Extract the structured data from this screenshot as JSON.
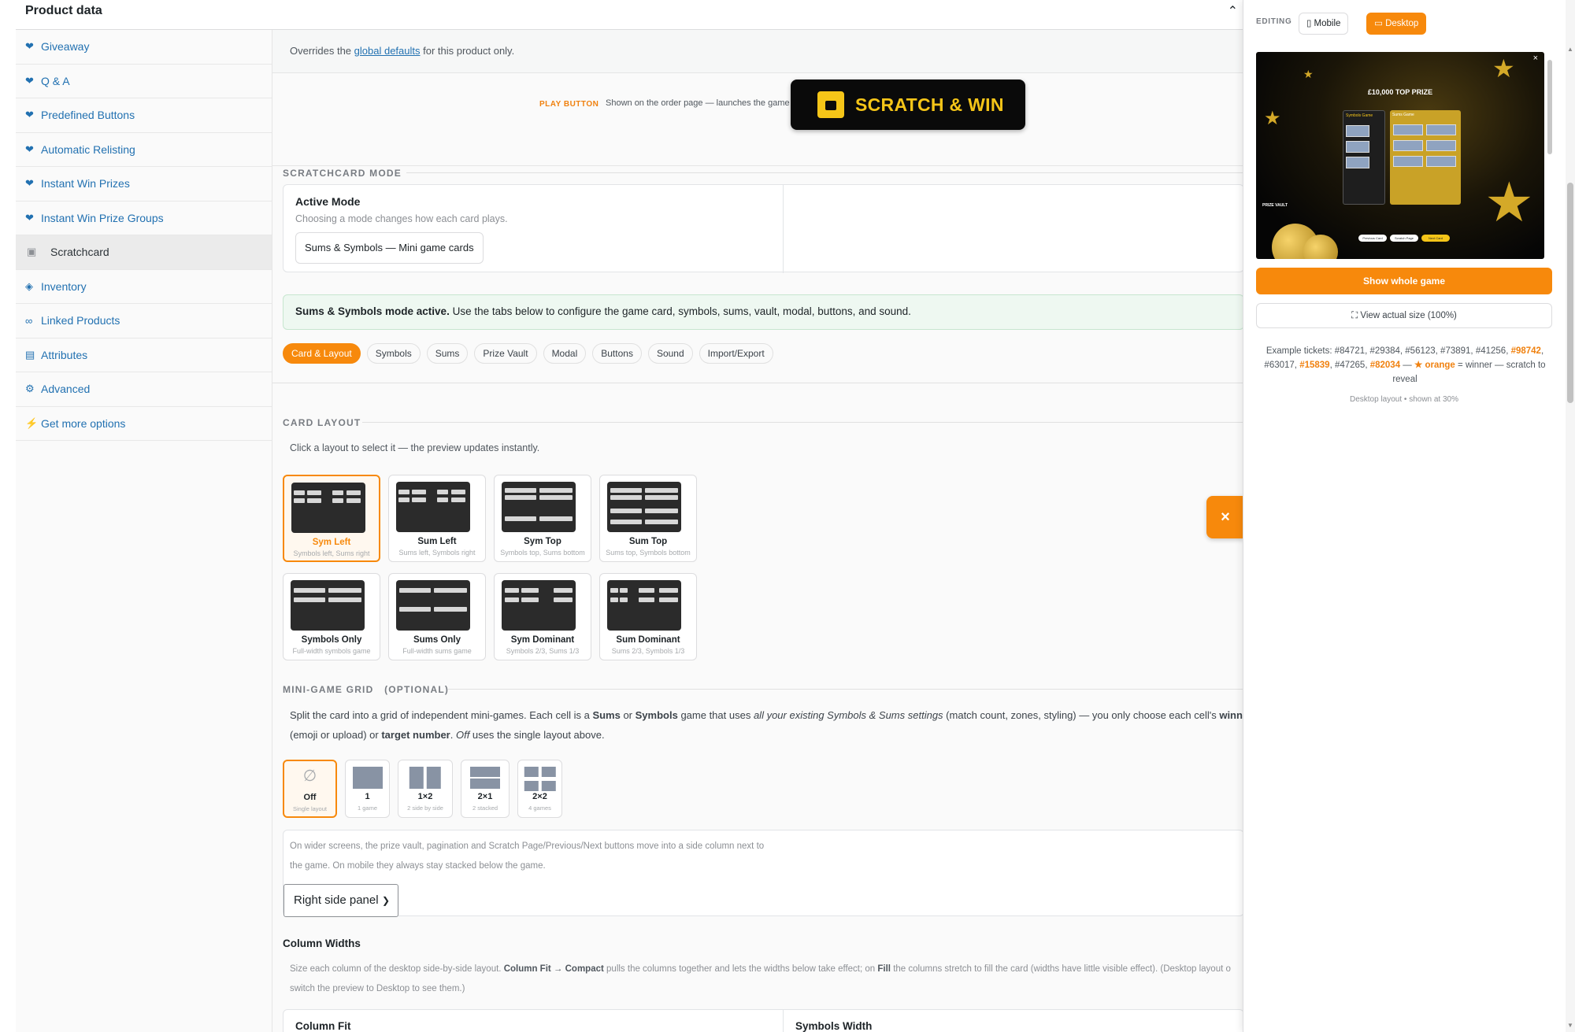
{
  "header": {
    "title": "Product data",
    "toggle_icon": "chevron-up-icon"
  },
  "sidebar": {
    "items": [
      {
        "label": "Giveaway",
        "icon": "gift-icon"
      },
      {
        "label": "Q & A",
        "icon": "question-icon"
      },
      {
        "label": "Predefined Buttons",
        "icon": "buttons-icon"
      },
      {
        "label": "Automatic Relisting",
        "icon": "relist-icon"
      },
      {
        "label": "Instant Win Prizes",
        "icon": "prize-icon"
      },
      {
        "label": "Instant Win Prize Groups",
        "icon": "prize-groups-icon"
      },
      {
        "label": "Scratchcard",
        "icon": "scratchcard-icon",
        "active": true
      },
      {
        "label": "Inventory",
        "icon": "inventory-icon"
      },
      {
        "label": "Linked Products",
        "icon": "link-icon"
      },
      {
        "label": "Attributes",
        "icon": "attributes-icon"
      },
      {
        "label": "Advanced",
        "icon": "gear-icon"
      },
      {
        "label": "Get more options",
        "icon": "plugin-icon"
      }
    ]
  },
  "overrides": {
    "prefix": "Overrides the ",
    "link": "global defaults",
    "suffix": " for this product only."
  },
  "play": {
    "label": "PLAY BUTTON",
    "desc": "Shown on the order page — launches the game",
    "button_text": "SCRATCH & WIN"
  },
  "scratchcard_mode": {
    "section": "SCRATCHCARD MODE",
    "title": "Active Mode",
    "subtitle": "Choosing a mode changes how each card plays.",
    "selected": "Sums & Symbols — Mini game cards"
  },
  "banner": {
    "bold": "Sums & Symbols mode active.",
    "rest": " Use the tabs below to configure the game card, symbols, sums, vault, modal, buttons, and sound."
  },
  "tabs": [
    "Card & Layout",
    "Symbols",
    "Sums",
    "Prize Vault",
    "Modal",
    "Buttons",
    "Sound",
    "Import/Export"
  ],
  "active_tab": "Card & Layout",
  "card_layout": {
    "section": "CARD LAYOUT",
    "hint": "Click a layout to select it — the preview updates instantly.",
    "options": [
      {
        "name": "Sym Left",
        "desc": "Symbols left, Sums right"
      },
      {
        "name": "Sum Left",
        "desc": "Sums left, Symbols right"
      },
      {
        "name": "Sym Top",
        "desc": "Symbols top, Sums bottom"
      },
      {
        "name": "Sum Top",
        "desc": "Sums top, Symbols bottom"
      },
      {
        "name": "Symbols Only",
        "desc": "Full-width symbols game"
      },
      {
        "name": "Sums Only",
        "desc": "Full-width sums game"
      },
      {
        "name": "Sym Dominant",
        "desc": "Symbols 2/3, Sums 1/3"
      },
      {
        "name": "Sum Dominant",
        "desc": "Sums 2/3, Symbols 1/3"
      }
    ],
    "selected": "Sym Left"
  },
  "mini_grid": {
    "section": "MINI-GAME GRID",
    "optional": "(OPTIONAL)",
    "desc_1a": "Split the card into a grid of independent mini-games. Each cell is a ",
    "sums": "Sums",
    "or": " or ",
    "symbols": "Symbols",
    "desc_1b": " game that uses ",
    "italic": "all your existing Symbols & Sums settings",
    "desc_1c": " (match count, zones, styling) — you only choose each cell's ",
    "winning": "winning sym",
    "desc_2a": "(emoji or upload) or ",
    "target": "target number",
    "desc_2b": ". ",
    "off_italic": "Off",
    "desc_2c": " uses the single layout above.",
    "options": [
      {
        "label": "Off",
        "sub": "Single layout"
      },
      {
        "label": "1",
        "sub": "1 game"
      },
      {
        "label": "1×2",
        "sub": "2 side by side"
      },
      {
        "label": "2×1",
        "sub": "2 stacked"
      },
      {
        "label": "2×2",
        "sub": "4 games"
      }
    ],
    "selected": "Off"
  },
  "side_panel": {
    "text_1": "On wider screens, the prize vault, pagination and Scratch Page/Previous/Next buttons move into a side column next to",
    "text_2": "the game. On mobile they always stay stacked below the game.",
    "select_value": "Right side panel"
  },
  "column_widths": {
    "title": "Column Widths",
    "text_1a": "Size each column of the desktop side-by-side layout. ",
    "cf": "Column Fit → Compact",
    "text_1b": " pulls the columns together and lets the widths below take effect; on ",
    "fill": "Fill",
    "text_1c": " the columns stretch to fill the card (widths have little visible effect). (Desktop layout o",
    "text_2": "switch the preview to Desktop to see them.)",
    "left_label": "Column Fit",
    "right_label": "Symbols Width"
  },
  "right_panel": {
    "editing": "EDITING",
    "mobile": "Mobile",
    "desktop": "Desktop",
    "active_device": "Desktop",
    "preview": {
      "title": "£10,000 TOP PRIZE",
      "vault_label": "PRIZE VAULT",
      "left_heading": "Symbols Game",
      "right_heading": "Sums Game",
      "buttons": [
        "Previous Card",
        "Scratch Page",
        "Next Card"
      ]
    },
    "show_whole": "Show whole game",
    "view_actual": "View actual size (100%)",
    "examples_prefix": "Example tickets: ",
    "tickets": [
      {
        "n": "#84721"
      },
      {
        "n": "#29384"
      },
      {
        "n": "#56123"
      },
      {
        "n": "#73891"
      },
      {
        "n": "#41256"
      },
      {
        "n": "#98742",
        "win": true
      },
      {
        "n": "#63017"
      },
      {
        "n": "#15839",
        "win": true
      },
      {
        "n": "#47265"
      },
      {
        "n": "#82034",
        "win": true
      }
    ],
    "examples_sep": " — ",
    "legend_star": "★ orange",
    "legend_rest": " = winner — scratch to reveal",
    "desktop_note": "Desktop layout • shown at 30%"
  },
  "close_fab": "×",
  "colors": {
    "accent": "#f7890c",
    "link": "#2271b1",
    "banner_bg": "#eef8f1",
    "gold": "#f5c518"
  }
}
